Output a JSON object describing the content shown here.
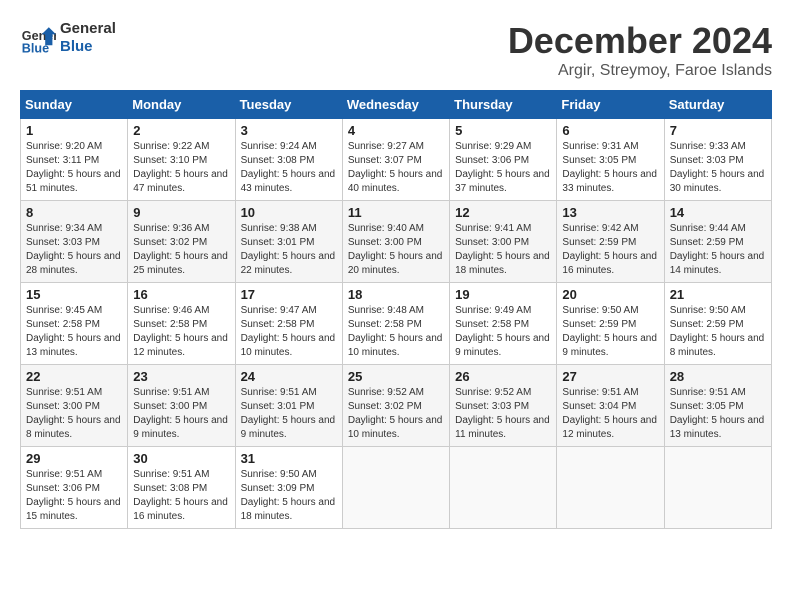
{
  "logo": {
    "text_general": "General",
    "text_blue": "Blue"
  },
  "header": {
    "month": "December 2024",
    "location": "Argir, Streymoy, Faroe Islands"
  },
  "weekdays": [
    "Sunday",
    "Monday",
    "Tuesday",
    "Wednesday",
    "Thursday",
    "Friday",
    "Saturday"
  ],
  "days": [
    {
      "num": "",
      "info": ""
    },
    {
      "num": "",
      "info": ""
    },
    {
      "num": "",
      "info": ""
    },
    {
      "num": "",
      "info": ""
    },
    {
      "num": "",
      "info": ""
    },
    {
      "num": "",
      "info": ""
    },
    {
      "num": "1",
      "info": "Sunrise: 9:20 AM\nSunset: 3:11 PM\nDaylight: 5 hours and 51 minutes."
    },
    {
      "num": "2",
      "info": "Sunrise: 9:22 AM\nSunset: 3:10 PM\nDaylight: 5 hours and 47 minutes."
    },
    {
      "num": "3",
      "info": "Sunrise: 9:24 AM\nSunset: 3:08 PM\nDaylight: 5 hours and 43 minutes."
    },
    {
      "num": "4",
      "info": "Sunrise: 9:27 AM\nSunset: 3:07 PM\nDaylight: 5 hours and 40 minutes."
    },
    {
      "num": "5",
      "info": "Sunrise: 9:29 AM\nSunset: 3:06 PM\nDaylight: 5 hours and 37 minutes."
    },
    {
      "num": "6",
      "info": "Sunrise: 9:31 AM\nSunset: 3:05 PM\nDaylight: 5 hours and 33 minutes."
    },
    {
      "num": "7",
      "info": "Sunrise: 9:33 AM\nSunset: 3:03 PM\nDaylight: 5 hours and 30 minutes."
    },
    {
      "num": "8",
      "info": "Sunrise: 9:34 AM\nSunset: 3:03 PM\nDaylight: 5 hours and 28 minutes."
    },
    {
      "num": "9",
      "info": "Sunrise: 9:36 AM\nSunset: 3:02 PM\nDaylight: 5 hours and 25 minutes."
    },
    {
      "num": "10",
      "info": "Sunrise: 9:38 AM\nSunset: 3:01 PM\nDaylight: 5 hours and 22 minutes."
    },
    {
      "num": "11",
      "info": "Sunrise: 9:40 AM\nSunset: 3:00 PM\nDaylight: 5 hours and 20 minutes."
    },
    {
      "num": "12",
      "info": "Sunrise: 9:41 AM\nSunset: 3:00 PM\nDaylight: 5 hours and 18 minutes."
    },
    {
      "num": "13",
      "info": "Sunrise: 9:42 AM\nSunset: 2:59 PM\nDaylight: 5 hours and 16 minutes."
    },
    {
      "num": "14",
      "info": "Sunrise: 9:44 AM\nSunset: 2:59 PM\nDaylight: 5 hours and 14 minutes."
    },
    {
      "num": "15",
      "info": "Sunrise: 9:45 AM\nSunset: 2:58 PM\nDaylight: 5 hours and 13 minutes."
    },
    {
      "num": "16",
      "info": "Sunrise: 9:46 AM\nSunset: 2:58 PM\nDaylight: 5 hours and 12 minutes."
    },
    {
      "num": "17",
      "info": "Sunrise: 9:47 AM\nSunset: 2:58 PM\nDaylight: 5 hours and 10 minutes."
    },
    {
      "num": "18",
      "info": "Sunrise: 9:48 AM\nSunset: 2:58 PM\nDaylight: 5 hours and 10 minutes."
    },
    {
      "num": "19",
      "info": "Sunrise: 9:49 AM\nSunset: 2:58 PM\nDaylight: 5 hours and 9 minutes."
    },
    {
      "num": "20",
      "info": "Sunrise: 9:50 AM\nSunset: 2:59 PM\nDaylight: 5 hours and 9 minutes."
    },
    {
      "num": "21",
      "info": "Sunrise: 9:50 AM\nSunset: 2:59 PM\nDaylight: 5 hours and 8 minutes."
    },
    {
      "num": "22",
      "info": "Sunrise: 9:51 AM\nSunset: 3:00 PM\nDaylight: 5 hours and 8 minutes."
    },
    {
      "num": "23",
      "info": "Sunrise: 9:51 AM\nSunset: 3:00 PM\nDaylight: 5 hours and 9 minutes."
    },
    {
      "num": "24",
      "info": "Sunrise: 9:51 AM\nSunset: 3:01 PM\nDaylight: 5 hours and 9 minutes."
    },
    {
      "num": "25",
      "info": "Sunrise: 9:52 AM\nSunset: 3:02 PM\nDaylight: 5 hours and 10 minutes."
    },
    {
      "num": "26",
      "info": "Sunrise: 9:52 AM\nSunset: 3:03 PM\nDaylight: 5 hours and 11 minutes."
    },
    {
      "num": "27",
      "info": "Sunrise: 9:51 AM\nSunset: 3:04 PM\nDaylight: 5 hours and 12 minutes."
    },
    {
      "num": "28",
      "info": "Sunrise: 9:51 AM\nSunset: 3:05 PM\nDaylight: 5 hours and 13 minutes."
    },
    {
      "num": "29",
      "info": "Sunrise: 9:51 AM\nSunset: 3:06 PM\nDaylight: 5 hours and 15 minutes."
    },
    {
      "num": "30",
      "info": "Sunrise: 9:51 AM\nSunset: 3:08 PM\nDaylight: 5 hours and 16 minutes."
    },
    {
      "num": "31",
      "info": "Sunrise: 9:50 AM\nSunset: 3:09 PM\nDaylight: 5 hours and 18 minutes."
    },
    {
      "num": "",
      "info": ""
    },
    {
      "num": "",
      "info": ""
    },
    {
      "num": "",
      "info": ""
    },
    {
      "num": "",
      "info": ""
    },
    {
      "num": "",
      "info": ""
    }
  ]
}
